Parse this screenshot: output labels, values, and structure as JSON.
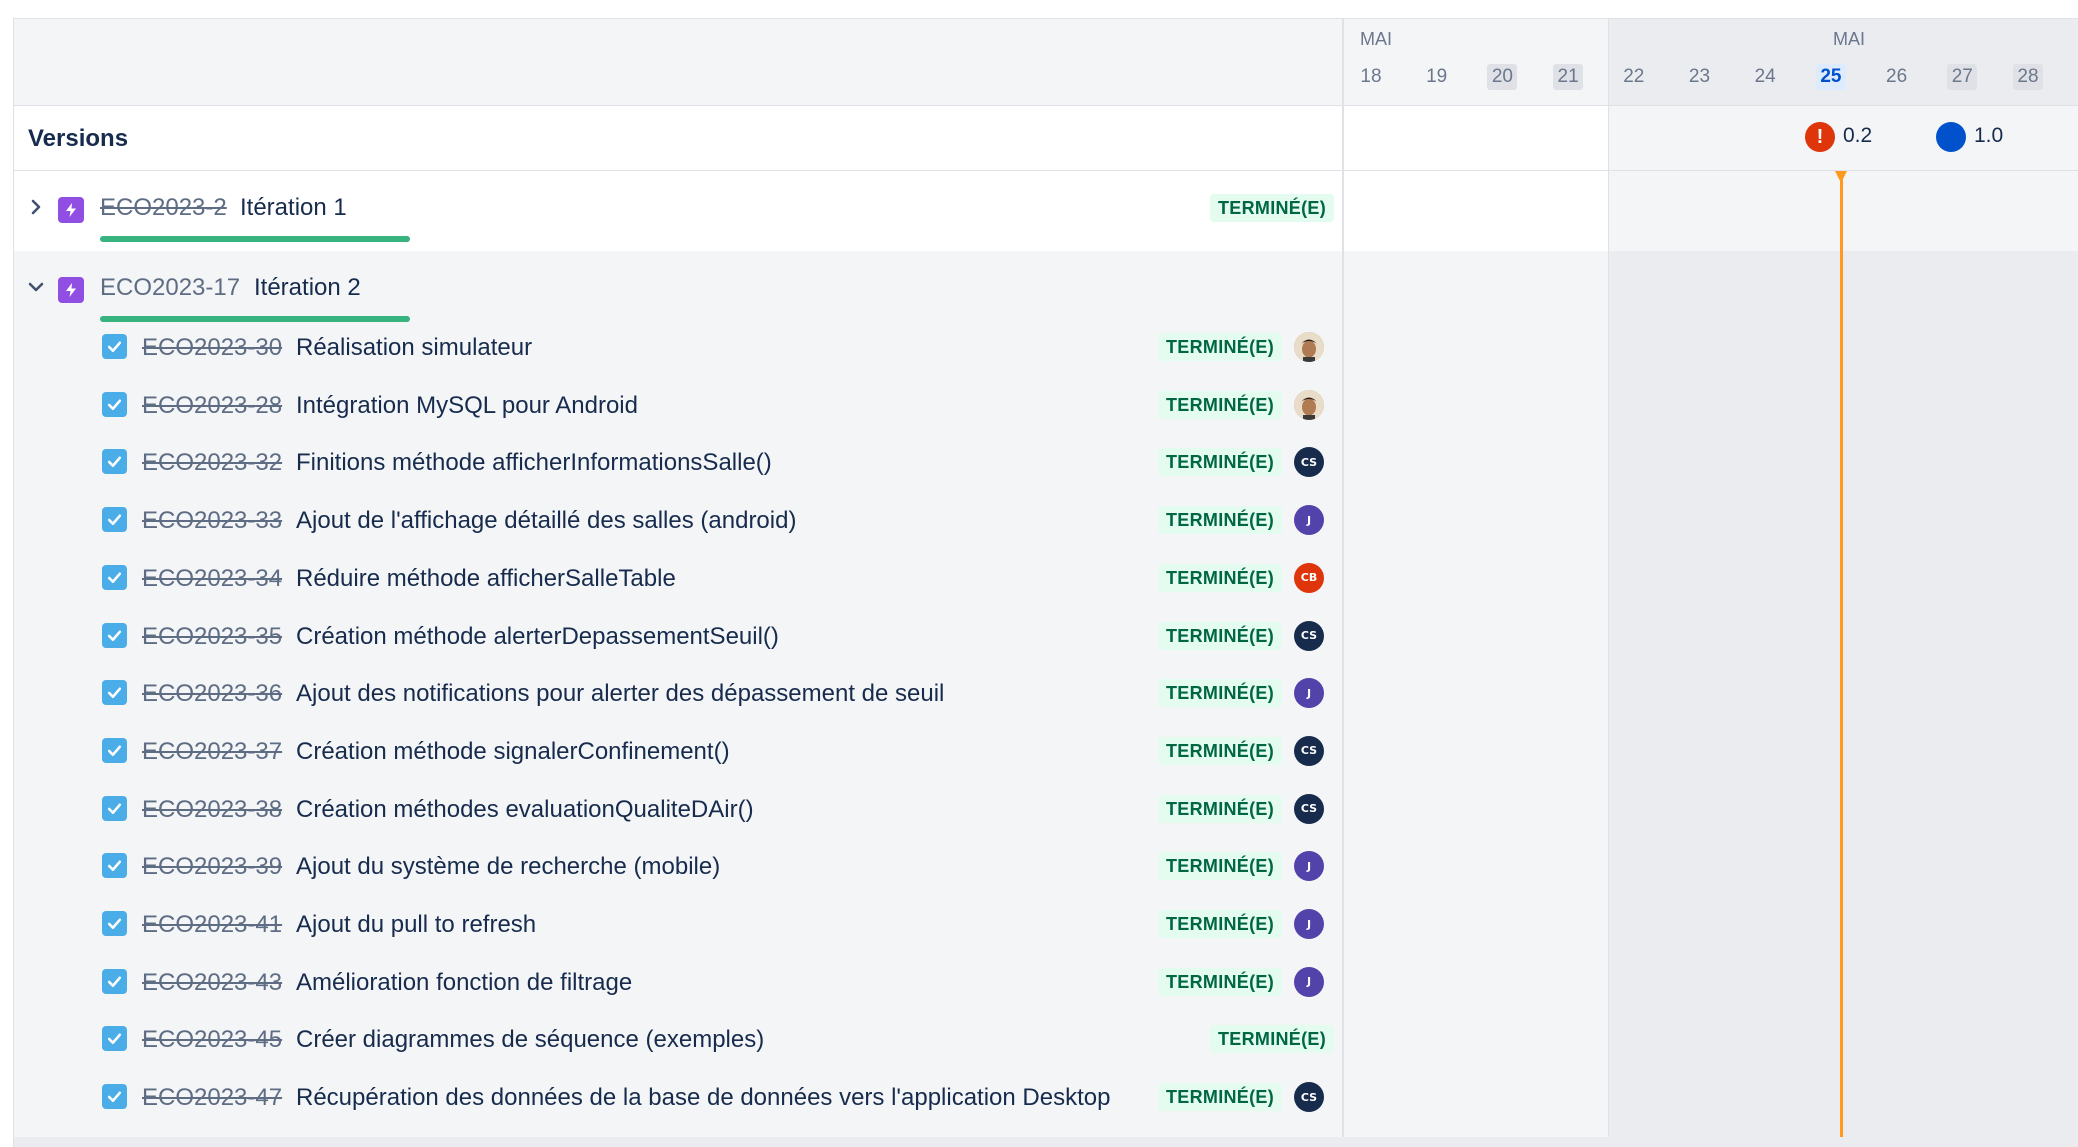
{
  "versions_title": "Versions",
  "timeline": {
    "months": [
      "MAI",
      "MAI"
    ],
    "days": [
      {
        "label": "18",
        "style": "normal"
      },
      {
        "label": "19",
        "style": "normal"
      },
      {
        "label": "20",
        "style": "weekend"
      },
      {
        "label": "21",
        "style": "weekend"
      },
      {
        "label": "22",
        "style": "normal"
      },
      {
        "label": "23",
        "style": "normal"
      },
      {
        "label": "24",
        "style": "normal"
      },
      {
        "label": "25",
        "style": "today"
      },
      {
        "label": "26",
        "style": "normal"
      },
      {
        "label": "27",
        "style": "weekend"
      },
      {
        "label": "28",
        "style": "weekend"
      }
    ],
    "today": "25",
    "version_markers": [
      {
        "label": "0.2",
        "icon": "exclamation-icon",
        "color": "#de350b"
      },
      {
        "label": "1.0",
        "icon": "circle-icon",
        "color": "#0052cc"
      }
    ]
  },
  "epics": [
    {
      "key": "ECO2023-2",
      "title": "Itération 1",
      "status": "TERMINÉ(E)",
      "expanded": false,
      "key_done": true
    },
    {
      "key": "ECO2023-17",
      "title": "Itération 2",
      "expanded": true,
      "key_done": false
    }
  ],
  "tasks": [
    {
      "key": "ECO2023-30",
      "title": "Réalisation simulateur",
      "status": "TERMINÉ(E)",
      "assignee": {
        "type": "photo",
        "initials": ""
      }
    },
    {
      "key": "ECO2023-28",
      "title": "Intégration MySQL pour Android",
      "status": "TERMINÉ(E)",
      "assignee": {
        "type": "photo",
        "initials": ""
      }
    },
    {
      "key": "ECO2023-32",
      "title": "Finitions méthode afficherInformationsSalle()",
      "status": "TERMINÉ(E)",
      "assignee": {
        "type": "initials",
        "initials": "CS",
        "color": "#172b4d"
      }
    },
    {
      "key": "ECO2023-33",
      "title": "Ajout de l'affichage détaillé des salles (android)",
      "status": "TERMINÉ(E)",
      "assignee": {
        "type": "initials",
        "initials": "J",
        "color": "#5243aa"
      }
    },
    {
      "key": "ECO2023-34",
      "title": "Réduire méthode afficherSalleTable",
      "status": "TERMINÉ(E)",
      "assignee": {
        "type": "initials",
        "initials": "CB",
        "color": "#de350b"
      }
    },
    {
      "key": "ECO2023-35",
      "title": "Création méthode alerterDepassementSeuil()",
      "status": "TERMINÉ(E)",
      "assignee": {
        "type": "initials",
        "initials": "CS",
        "color": "#172b4d"
      }
    },
    {
      "key": "ECO2023-36",
      "title": "Ajout des notifications pour alerter des dépassement de seuil",
      "status": "TERMINÉ(E)",
      "assignee": {
        "type": "initials",
        "initials": "J",
        "color": "#5243aa"
      }
    },
    {
      "key": "ECO2023-37",
      "title": "Création méthode signalerConfinement()",
      "status": "TERMINÉ(E)",
      "assignee": {
        "type": "initials",
        "initials": "CS",
        "color": "#172b4d"
      }
    },
    {
      "key": "ECO2023-38",
      "title": "Création méthodes evaluationQualiteDAir()",
      "status": "TERMINÉ(E)",
      "assignee": {
        "type": "initials",
        "initials": "CS",
        "color": "#172b4d"
      }
    },
    {
      "key": "ECO2023-39",
      "title": "Ajout du système de recherche (mobile)",
      "status": "TERMINÉ(E)",
      "assignee": {
        "type": "initials",
        "initials": "J",
        "color": "#5243aa"
      }
    },
    {
      "key": "ECO2023-41",
      "title": "Ajout du pull to refresh",
      "status": "TERMINÉ(E)",
      "assignee": {
        "type": "initials",
        "initials": "J",
        "color": "#5243aa"
      }
    },
    {
      "key": "ECO2023-43",
      "title": "Amélioration fonction de filtrage",
      "status": "TERMINÉ(E)",
      "assignee": {
        "type": "initials",
        "initials": "J",
        "color": "#5243aa"
      }
    },
    {
      "key": "ECO2023-45",
      "title": "Créer diagrammes de séquence (exemples)",
      "status": "TERMINÉ(E)",
      "assignee": null
    },
    {
      "key": "ECO2023-47",
      "title": "Récupération des données de la base de données vers l'application Desktop",
      "status": "TERMINÉ(E)",
      "assignee": {
        "type": "initials",
        "initials": "CS",
        "color": "#172b4d"
      }
    }
  ]
}
